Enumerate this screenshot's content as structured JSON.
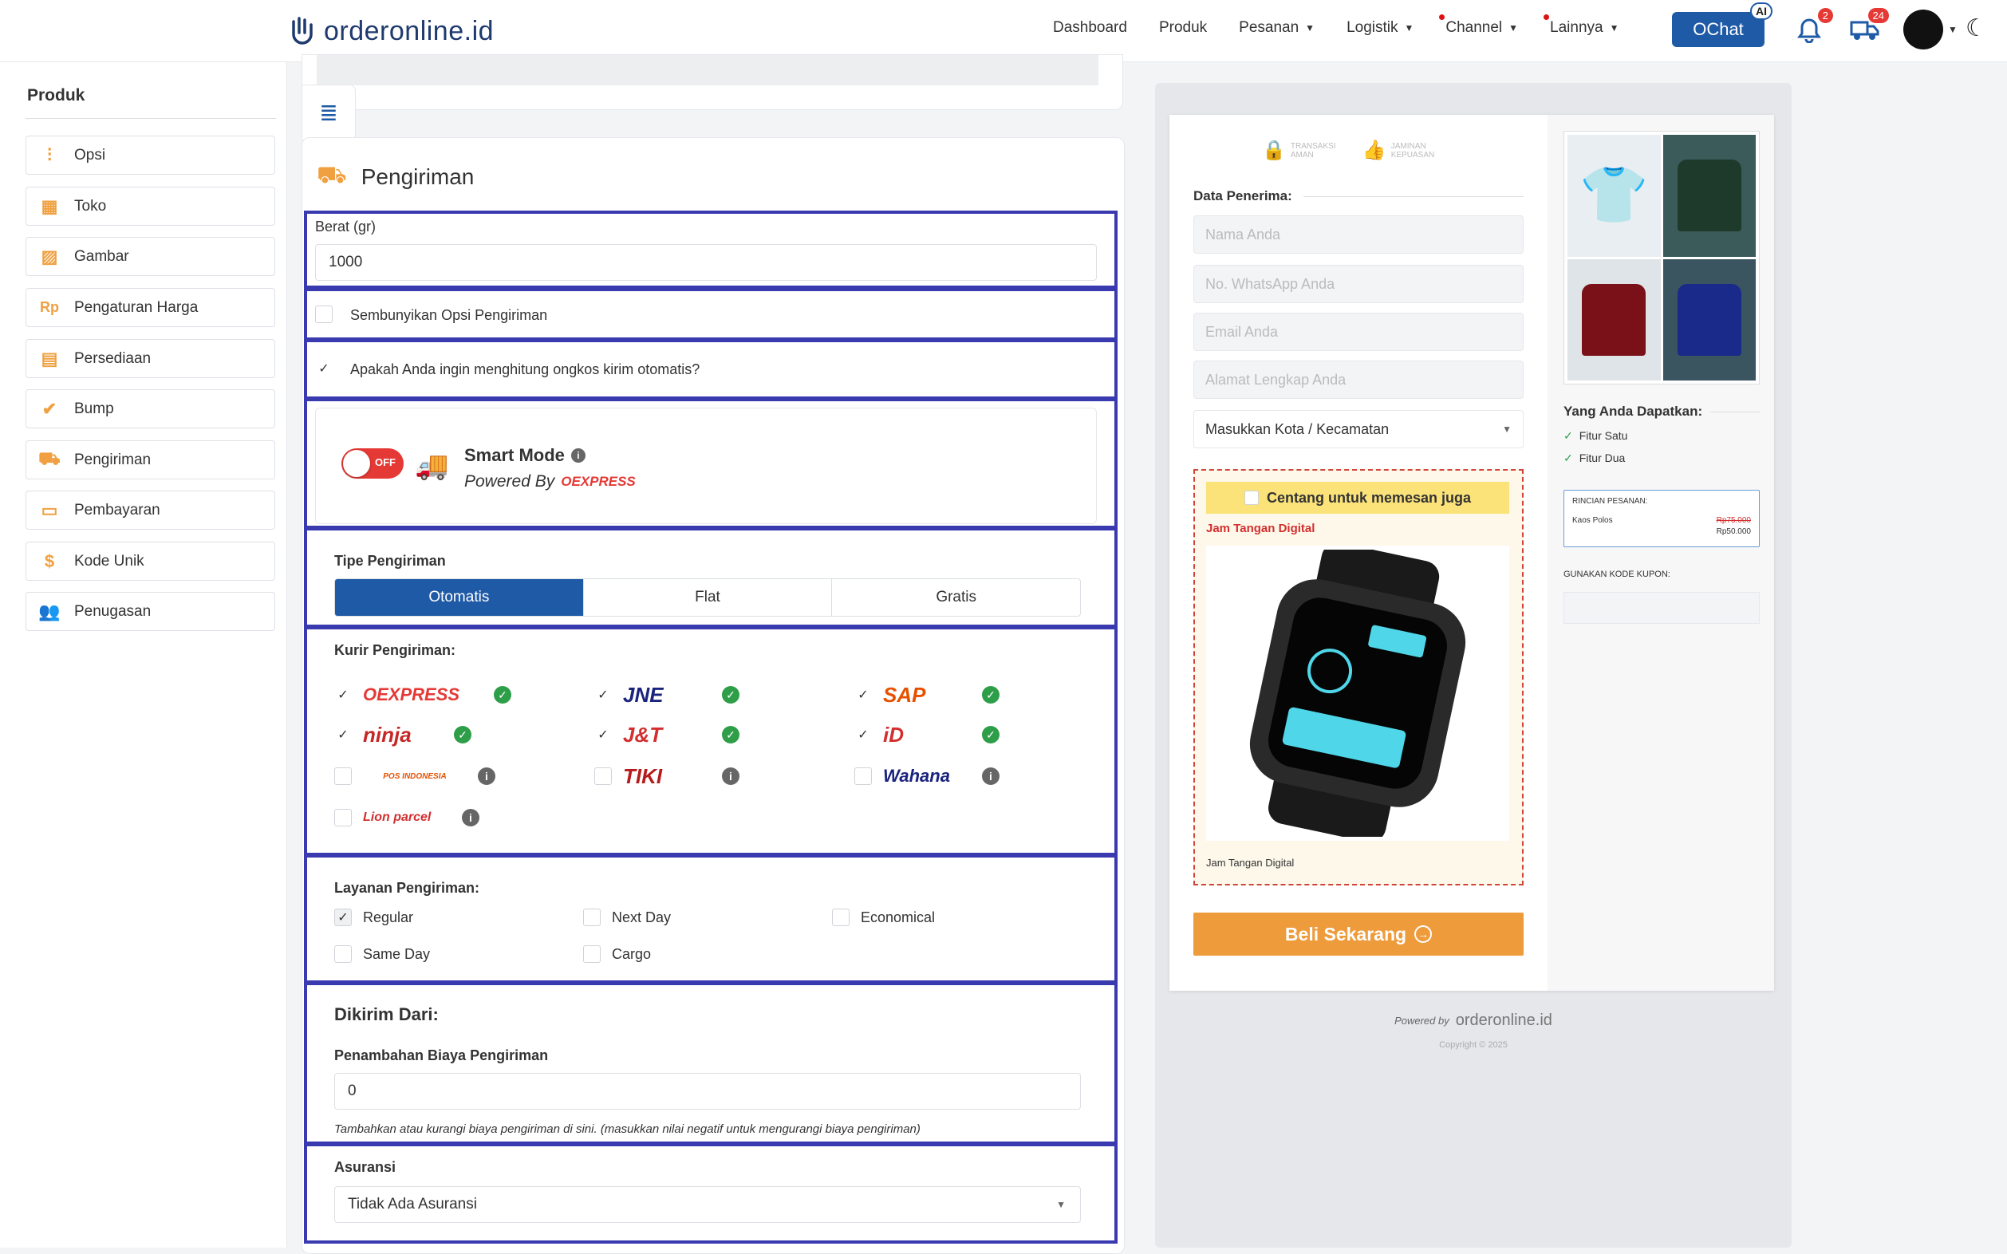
{
  "brand": {
    "name": "orderonline.id"
  },
  "nav": {
    "items": [
      "Dashboard",
      "Produk",
      "Pesanan",
      "Logistik",
      "Channel",
      "Lainnya"
    ],
    "ochat": "OChat",
    "ai": "AI",
    "notif_count": "2",
    "shipping_count": "24"
  },
  "sidebar": {
    "title": "Produk",
    "items": [
      {
        "label": "Opsi",
        "icon": "sliders-icon"
      },
      {
        "label": "Toko",
        "icon": "store-icon"
      },
      {
        "label": "Gambar",
        "icon": "image-icon"
      },
      {
        "label": "Pengaturan Harga",
        "icon": "rp-icon"
      },
      {
        "label": "Persediaan",
        "icon": "clipboard-icon"
      },
      {
        "label": "Bump",
        "icon": "check-icon"
      },
      {
        "label": "Pengiriman",
        "icon": "truck-icon"
      },
      {
        "label": "Pembayaran",
        "icon": "card-icon"
      },
      {
        "label": "Kode Unik",
        "icon": "dollar-icon"
      },
      {
        "label": "Penugasan",
        "icon": "users-icon"
      }
    ]
  },
  "shipping": {
    "title": "Pengiriman",
    "weight_label": "Berat (gr)",
    "weight_value": "1000",
    "hide_option_label": "Sembunyikan Opsi Pengiriman",
    "auto_calc_label": "Apakah Anda ingin menghitung ongkos kirim otomatis?",
    "smart_mode_title": "Smart Mode",
    "smart_mode_powered": "Powered By",
    "smart_mode_brand": "OEXPRESS",
    "toggle_state": "OFF",
    "type_label": "Tipe Pengiriman",
    "type_options": [
      "Otomatis",
      "Flat",
      "Gratis"
    ],
    "courier_label": "Kurir Pengiriman:",
    "couriers": [
      {
        "name": "OEXPRESS",
        "checked": true,
        "status": "ok",
        "color": "#e53935"
      },
      {
        "name": "JNE",
        "checked": true,
        "status": "ok",
        "color": "#1a237e"
      },
      {
        "name": "SAP",
        "checked": true,
        "status": "ok",
        "color": "#e65100"
      },
      {
        "name": "ninja",
        "checked": true,
        "status": "ok",
        "color": "#c62828"
      },
      {
        "name": "J&T",
        "checked": true,
        "status": "ok",
        "color": "#d32f2f"
      },
      {
        "name": "iD",
        "checked": true,
        "status": "ok",
        "color": "#d32f2f"
      },
      {
        "name": "POS INDONESIA",
        "checked": false,
        "status": "info",
        "color": "#e65100"
      },
      {
        "name": "TIKI",
        "checked": false,
        "status": "info",
        "color": "#b71c1c"
      },
      {
        "name": "Wahana",
        "checked": false,
        "status": "info",
        "color": "#1a237e"
      },
      {
        "name": "Lion parcel",
        "checked": false,
        "status": "info",
        "color": "#d32f2f"
      }
    ],
    "service_label": "Layanan Pengiriman:",
    "services": [
      {
        "name": "Regular",
        "checked": true
      },
      {
        "name": "Next Day",
        "checked": false
      },
      {
        "name": "Economical",
        "checked": false
      },
      {
        "name": "Same Day",
        "checked": false
      },
      {
        "name": "Cargo",
        "checked": false
      }
    ],
    "from_label": "Dikirim Dari:",
    "extra_fee_label": "Penambahan Biaya Pengiriman",
    "extra_fee_value": "0",
    "extra_fee_hint": "Tambahkan atau kurangi biaya pengiriman di sini. (masukkan nilai negatif untuk mengurangi biaya pengiriman)",
    "insurance_label": "Asuransi",
    "insurance_value": "Tidak Ada Asuransi"
  },
  "preview": {
    "trust1": "TRANSAKSI AMAN",
    "trust2": "JAMINAN KEPUASAN",
    "recipient_label": "Data Penerima:",
    "name_ph": "Nama Anda",
    "wa_ph": "No. WhatsApp Anda",
    "email_ph": "Email Anda",
    "address_ph": "Alamat Lengkap Anda",
    "city_select": "Masukkan Kota / Kecamatan",
    "bump_title": "Centang untuk memesan juga",
    "bump_product": "Jam Tangan Digital",
    "bump_caption": "Jam Tangan Digital",
    "buy_button": "Beli Sekarang",
    "benefits_label": "Yang Anda Dapatkan:",
    "benefits": [
      "Fitur Satu",
      "Fitur Dua"
    ],
    "order_detail_label": "RINCIAN PESANAN:",
    "order_item": "Kaos Polos",
    "order_old_price": "Rp75.000",
    "order_price": "Rp50.000",
    "coupon_label": "GUNAKAN KODE KUPON:",
    "powered_by": "Powered by",
    "powered_brand": "orderonline.id",
    "copyright": "Copyright © 2025"
  }
}
